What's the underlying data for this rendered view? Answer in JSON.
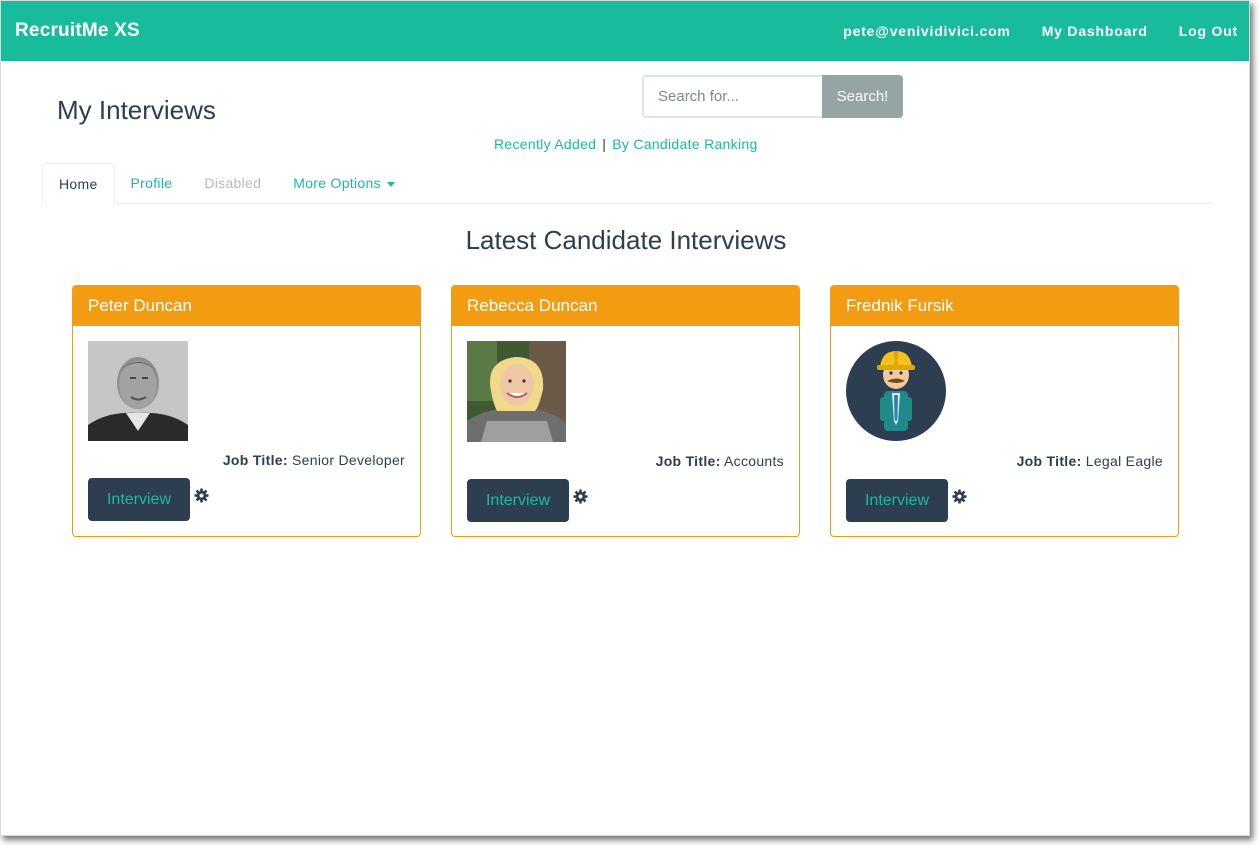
{
  "app": {
    "title": "RecruitMe XS"
  },
  "nav": {
    "email": "pete@venividivici.com",
    "dashboard": "My Dashboard",
    "logout": "Log Out"
  },
  "page": {
    "title": "My Interviews"
  },
  "search": {
    "placeholder": "Search for...",
    "button": "Search!"
  },
  "sort": {
    "recent": "Recently Added",
    "separator": "|",
    "ranking": "By Candidate Ranking"
  },
  "tabs": [
    {
      "label": "Home",
      "state": "active"
    },
    {
      "label": "Profile",
      "state": "link"
    },
    {
      "label": "Disabled",
      "state": "disabled"
    },
    {
      "label": "More Options",
      "state": "dropdown"
    }
  ],
  "section": {
    "title": "Latest Candidate Interviews"
  },
  "candidates": [
    {
      "name": "Peter Duncan",
      "job_label": "Job Title:",
      "job_title": "Senior Developer",
      "button": "Interview",
      "avatar": "grayscale-photo"
    },
    {
      "name": "Rebecca Duncan",
      "job_label": "Job Title:",
      "job_title": "Accounts",
      "button": "Interview",
      "avatar": "color-photo"
    },
    {
      "name": "Frednik Fursik",
      "job_label": "Job Title:",
      "job_title": "Legal Eagle",
      "button": "Interview",
      "avatar": "hardhat-character-icon"
    }
  ],
  "colors": {
    "primary": "#18bc9c",
    "dark": "#2c3e50",
    "warning": "#f39c12",
    "muted": "#95a5a6"
  }
}
